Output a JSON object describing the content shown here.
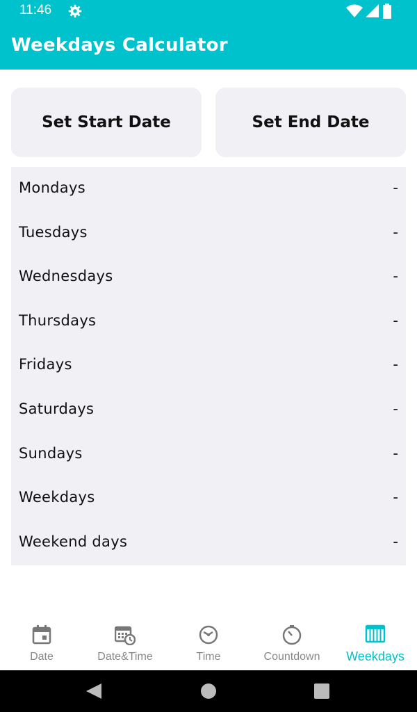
{
  "status_bar": {
    "time": "11:46",
    "icons": [
      "gear-icon",
      "wifi-icon",
      "signal-icon",
      "battery-icon"
    ]
  },
  "app_bar": {
    "title": "Weekdays Calculator"
  },
  "buttons": {
    "start": "Set Start Date",
    "end": "Set End Date"
  },
  "results": [
    {
      "label": "Mondays",
      "value": "-"
    },
    {
      "label": "Tuesdays",
      "value": "-"
    },
    {
      "label": "Wednesdays",
      "value": "-"
    },
    {
      "label": "Thursdays",
      "value": "-"
    },
    {
      "label": "Fridays",
      "value": "-"
    },
    {
      "label": "Saturdays",
      "value": "-"
    },
    {
      "label": "Sundays",
      "value": "-"
    },
    {
      "label": "Weekdays",
      "value": "-"
    },
    {
      "label": "Weekend days",
      "value": "-"
    }
  ],
  "bottom_nav": [
    {
      "label": "Date",
      "icon": "calendar-icon"
    },
    {
      "label": "Date&Time",
      "icon": "calendar-clock-icon"
    },
    {
      "label": "Time",
      "icon": "clock-icon"
    },
    {
      "label": "Countdown",
      "icon": "timer-icon"
    },
    {
      "label": "Weekdays",
      "icon": "weekdays-grid-icon",
      "active": true
    }
  ],
  "colors": {
    "accent": "#00C2CD",
    "surface": "#F0F0F5",
    "inactive": "#888888"
  }
}
